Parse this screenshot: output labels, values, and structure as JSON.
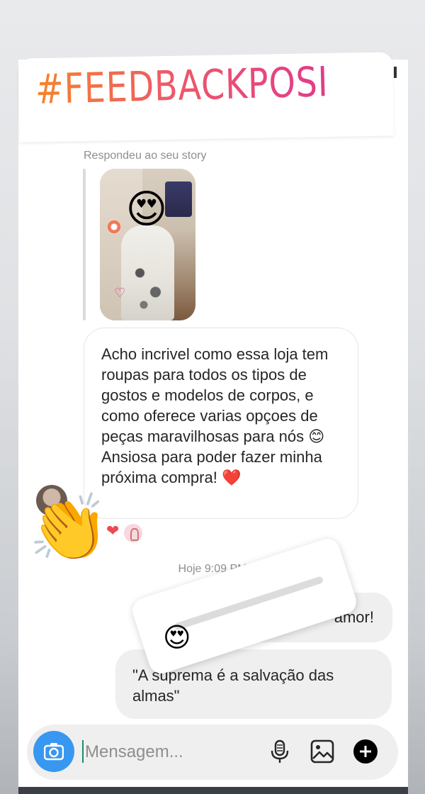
{
  "header": {
    "hashtag": "#FEEDBACKPOSITIVO"
  },
  "story_reply": {
    "label": "Respondeu ao seu story",
    "sticker_emoji": "😍"
  },
  "messages": {
    "received": "Acho incrivel como essa loja tem roupas para todos os tipos de gostos e modelos de corpos, e como oferece varias opçoes de peças maravilhosas para nós 😊\nAnsiosa para poder fazer minha próxima compra! ❤️",
    "reaction_heart": "❤",
    "timestamp": "Hoje 9:09 PM",
    "sent_1": "amor!",
    "sent_2": "\"A    suprema é a salvação das almas\""
  },
  "stickers": {
    "clap_emoji": "👏",
    "slider_emoji": "😍"
  },
  "composer": {
    "placeholder": "Mensagem..."
  },
  "colors": {
    "accent_blue": "#3897f0",
    "bubble_grey": "#efefef",
    "gradient_start": "#f58529",
    "gradient_end": "#e13b8a"
  },
  "icons": [
    "camera-icon",
    "microphone-icon",
    "gallery-icon",
    "add-icon"
  ]
}
